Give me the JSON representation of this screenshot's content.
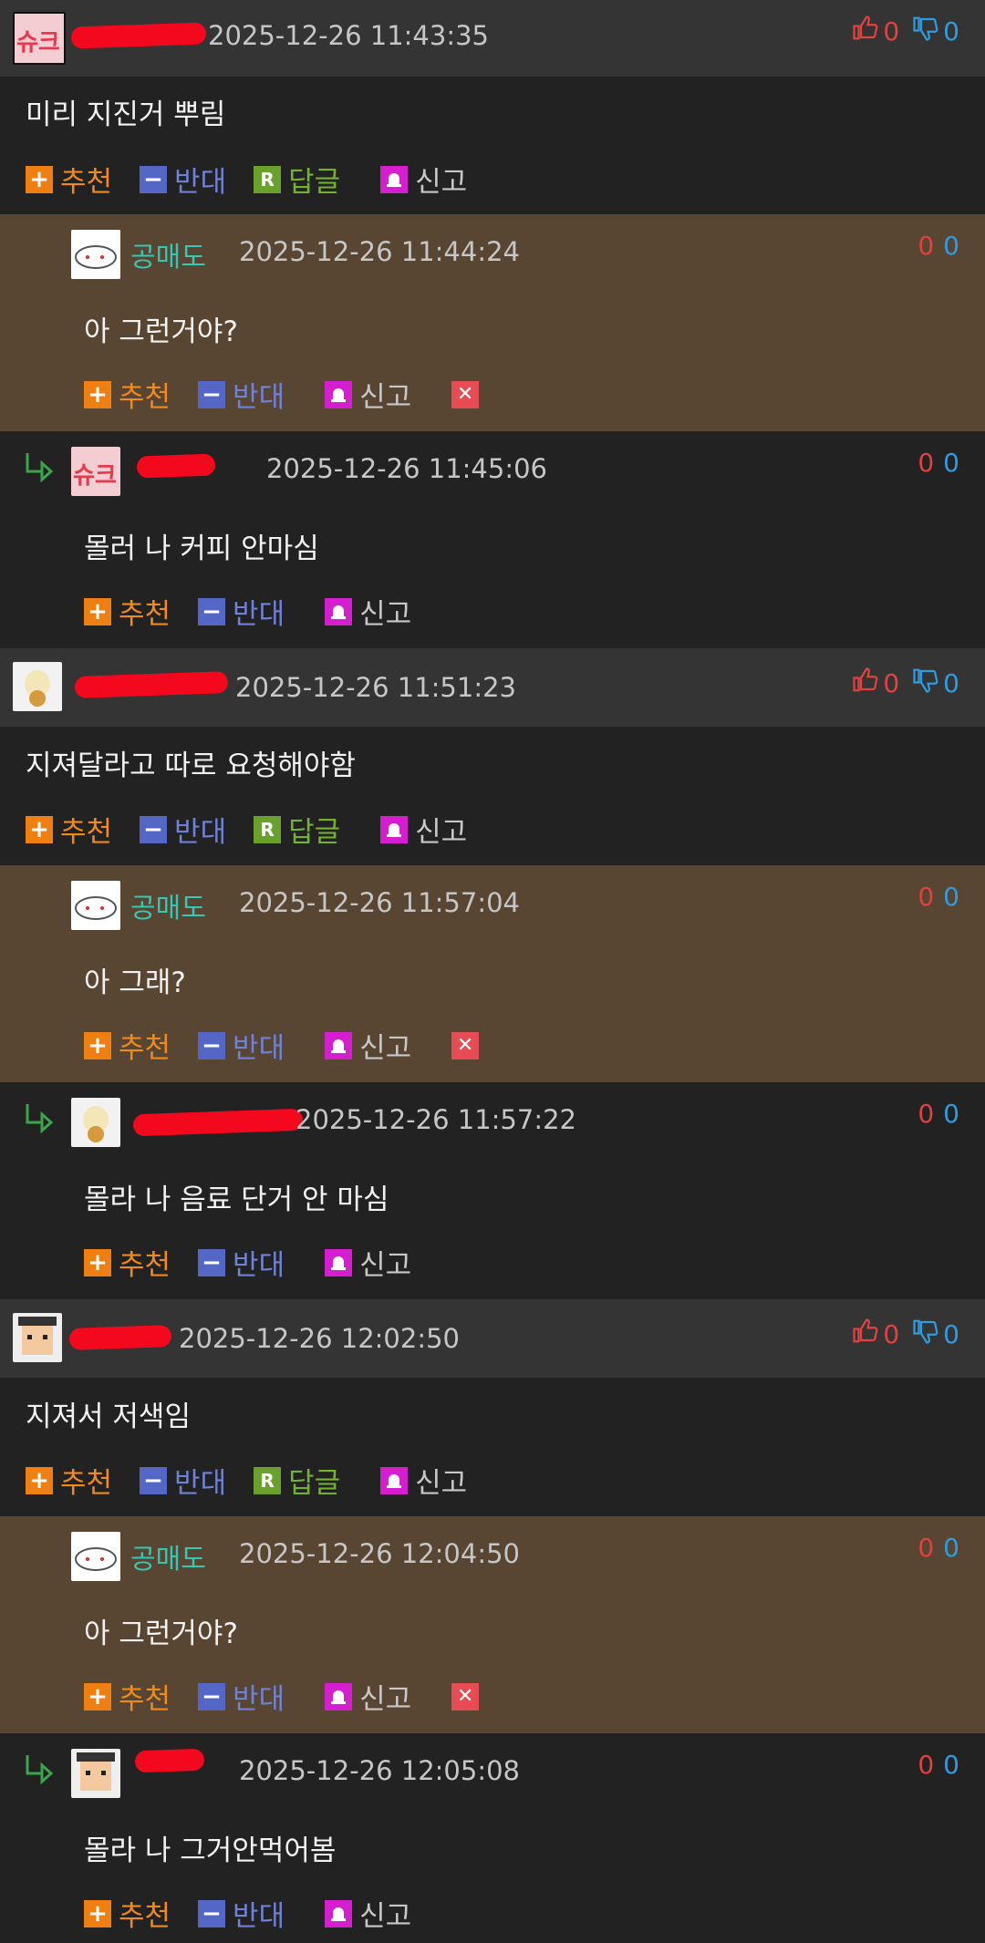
{
  "labels": {
    "recommend": "추천",
    "oppose": "반대",
    "reply": "답글",
    "report": "신고",
    "reply_badge": "R",
    "plus": "+",
    "minus": "−",
    "delete": "✕"
  },
  "comments": [
    {
      "kind": "top",
      "nick": "",
      "time": "2025-12-26 11:43:35",
      "text": "미리 지진거 뿌림",
      "up": "0",
      "down": "0"
    },
    {
      "kind": "mine",
      "nick": "공매도",
      "time": "2025-12-26 11:44:24",
      "text": "아 그런거야?",
      "up": "0",
      "down": "0"
    },
    {
      "kind": "reply",
      "nick": "",
      "time": "2025-12-26 11:45:06",
      "text": "몰러 나 커피 안마심",
      "up": "0",
      "down": "0"
    },
    {
      "kind": "top",
      "nick": "",
      "time": "2025-12-26 11:51:23",
      "text": "지져달라고 따로 요청해야함",
      "up": "0",
      "down": "0"
    },
    {
      "kind": "mine",
      "nick": "공매도",
      "time": "2025-12-26 11:57:04",
      "text": "아 그래?",
      "up": "0",
      "down": "0"
    },
    {
      "kind": "reply",
      "nick": "",
      "time": "2025-12-26 11:57:22",
      "text": "몰라 나 음료 단거 안 마심",
      "up": "0",
      "down": "0"
    },
    {
      "kind": "top",
      "nick": "",
      "time": "2025-12-26 12:02:50",
      "text": "지져서 저색임",
      "up": "0",
      "down": "0"
    },
    {
      "kind": "mine",
      "nick": "공매도",
      "time": "2025-12-26 12:04:50",
      "text": "아 그런거야?",
      "up": "0",
      "down": "0"
    },
    {
      "kind": "reply",
      "nick": "",
      "time": "2025-12-26 12:05:08",
      "text": "몰라 나 그거안먹어봄",
      "up": "0",
      "down": "0"
    }
  ],
  "icons": {
    "thumb_up": "thumb-up-icon",
    "thumb_down": "thumb-down-icon",
    "reply_arrow": "reply-arrow-icon",
    "report": "siren-icon",
    "delete": "close-icon"
  },
  "colors": {
    "background": "#222222",
    "my_comment_bg": "#584532",
    "header_bg": "#343434",
    "nick_self": "#35c8b4",
    "nick_other": "#f08a1a",
    "vote_up": "#e34040",
    "vote_down": "#2f9be0"
  }
}
